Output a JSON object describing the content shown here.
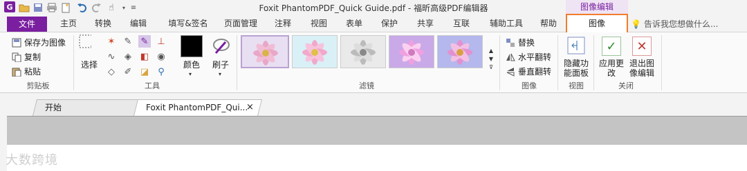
{
  "window": {
    "title": "Foxit PhantomPDF_Quick Guide.pdf - 福昕高级PDF编辑器",
    "context_tab_label": "图像编辑",
    "app_logo": "G"
  },
  "quick_access": [
    "app-logo-icon",
    "open-folder-icon",
    "save-icon",
    "print-icon",
    "new-icon",
    "undo-icon",
    "redo-icon",
    "hand-icon",
    "customize-icon"
  ],
  "tabs": {
    "file": "文件",
    "items": [
      "主页",
      "转换",
      "编辑",
      "填写&签名",
      "页面管理",
      "注释",
      "视图",
      "表单",
      "保护",
      "共享",
      "互联",
      "辅助工具",
      "帮助"
    ],
    "active": "图像",
    "tell_me": "告诉我您想做什么..."
  },
  "ribbon": {
    "clipboard": {
      "save_as_image": "保存为图像",
      "copy": "复制",
      "paste": "粘贴",
      "label": "剪贴板"
    },
    "tools": {
      "select": "选择",
      "color": "颜色",
      "brush": "刷子",
      "label": "工具",
      "swatch_color": "#000000"
    },
    "filters": {
      "label": "滤镜",
      "thumbnails": [
        "original",
        "cool",
        "grayscale",
        "violet",
        "purple"
      ],
      "selected_index": 0
    },
    "image": {
      "replace": "替换",
      "flip_horizontal": "水平翻转",
      "flip_vertical": "垂直翻转",
      "label": "图像"
    },
    "view": {
      "hide_panel": "隐藏功能面板",
      "label": "视图"
    },
    "close": {
      "apply": "应用更改",
      "exit": "退出图像编辑",
      "label": "关闭"
    }
  },
  "doc_tabs": [
    {
      "label": "开始",
      "active": false
    },
    {
      "label": "Foxit PhantomPDF_Qui...",
      "active": true,
      "close": "×"
    }
  ],
  "watermark": "大数跨境",
  "colors": {
    "brand": "#7a1fa0",
    "highlight": "#f07c2a"
  }
}
